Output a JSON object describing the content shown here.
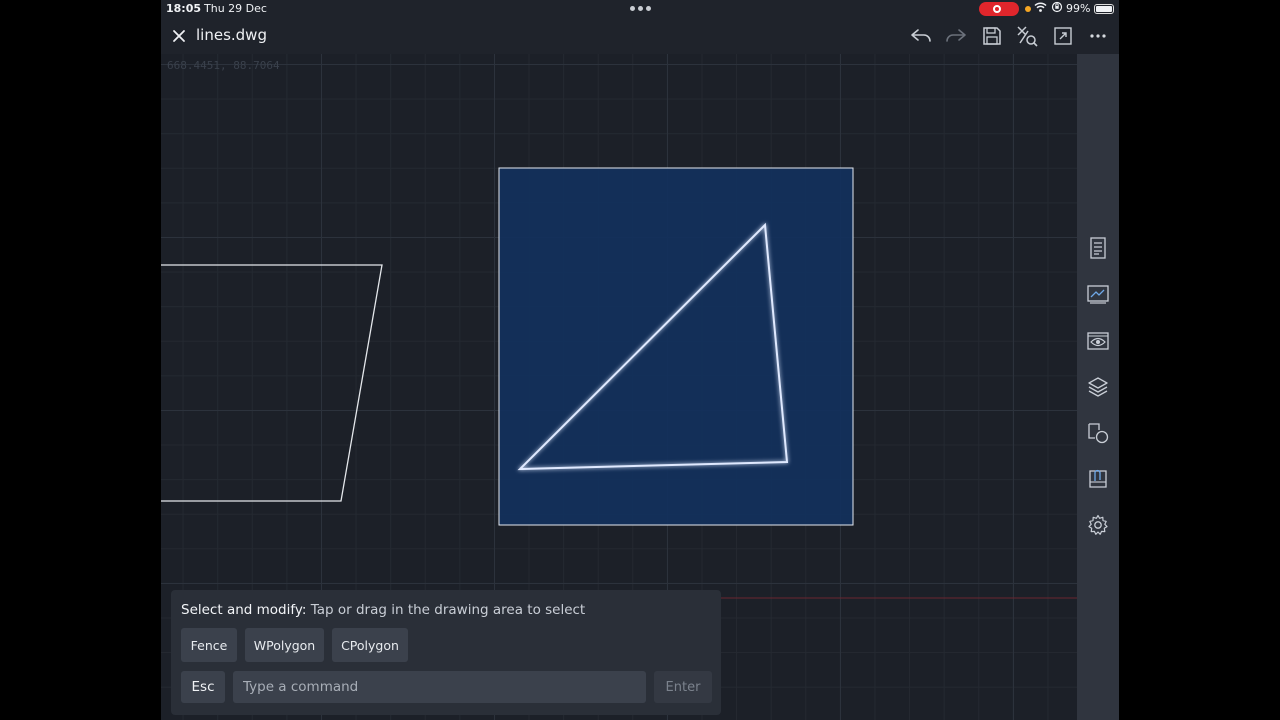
{
  "status_bar": {
    "time": "18:05",
    "date": "Thu 29 Dec",
    "battery_percent": "99%",
    "battery_level": 0.99
  },
  "title_bar": {
    "file_name": "lines.dwg"
  },
  "canvas": {
    "coordinate_readout": "668.4451, 88.7064"
  },
  "command_panel": {
    "prompt_command": "Select and modify:",
    "prompt_text": " Tap or drag in the drawing area to select",
    "options": [
      {
        "label": "Fence"
      },
      {
        "label": "WPolygon"
      },
      {
        "label": "CPolygon"
      }
    ],
    "esc_label": "Esc",
    "input_placeholder": "Type a command",
    "input_value": "",
    "enter_label": "Enter"
  },
  "colors": {
    "accent_selection": "#12305c",
    "recording": "#e0262c"
  }
}
